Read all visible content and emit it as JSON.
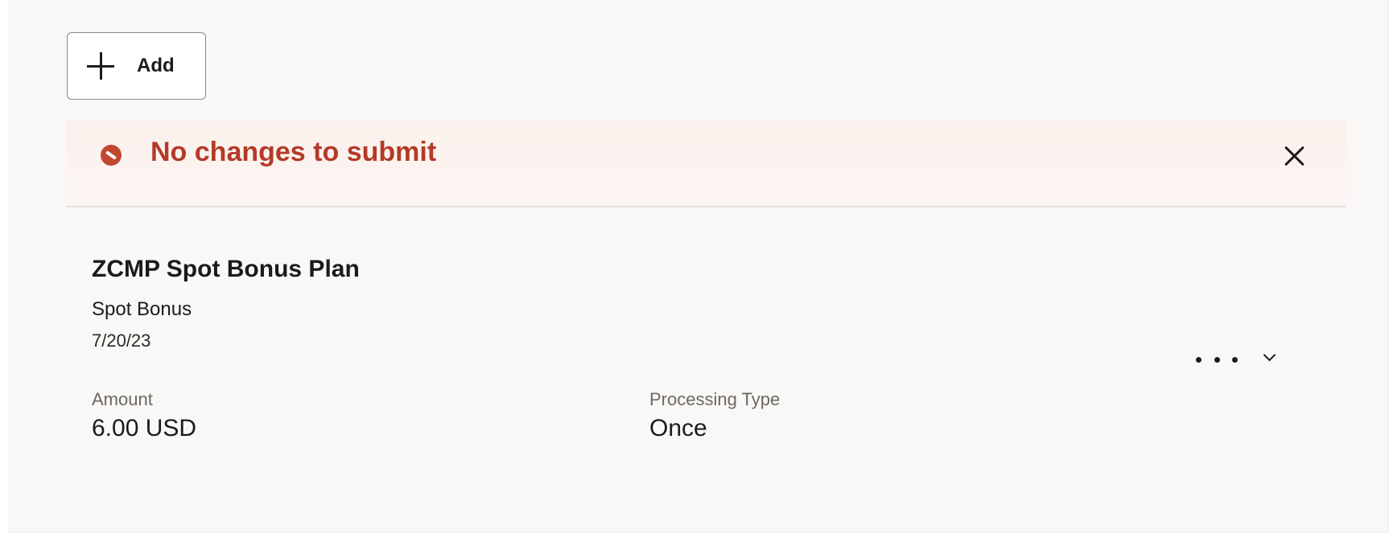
{
  "toolbar": {
    "add_label": "Add",
    "add_icon": "plus-icon"
  },
  "message_banner": {
    "severity": "error",
    "icon": "error-icon",
    "text": "No changes to submit",
    "close_icon": "close-icon",
    "accent_color": "#b43a27"
  },
  "card": {
    "title": "ZCMP Spot Bonus Plan",
    "subtitle": "Spot Bonus",
    "date": "7/20/23",
    "fields": [
      {
        "label": "Amount",
        "value": "6.00 USD"
      },
      {
        "label": "Processing Type",
        "value": "Once"
      }
    ],
    "actions": {
      "more_icon": "more-horizontal-icon",
      "expand_icon": "chevron-down-icon"
    }
  }
}
